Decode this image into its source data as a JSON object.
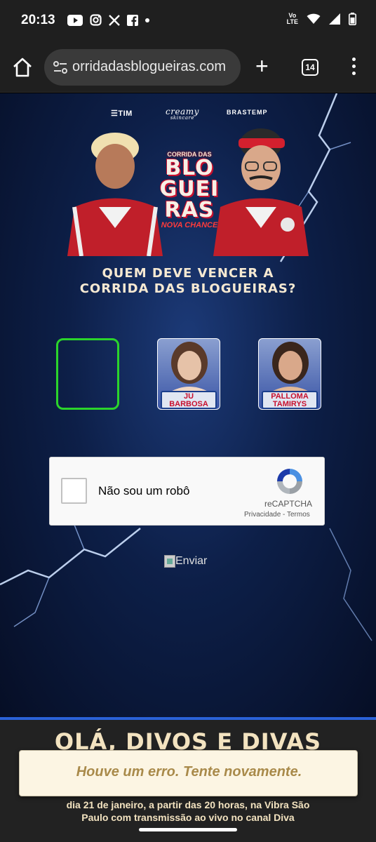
{
  "status_bar": {
    "time": "20:13",
    "notification_icons": [
      "youtube-icon",
      "instagram-icon",
      "x-icon",
      "facebook-icon",
      "dot-icon"
    ],
    "network_label_top": "Vo",
    "network_label_bottom": "LTE",
    "system_icons": [
      "wifi-icon",
      "signal-icon",
      "battery-icon"
    ]
  },
  "browser": {
    "url": "orridadasblogueiras.com",
    "tab_count": "14",
    "icons": [
      "home-icon",
      "site-settings-icon",
      "new-tab-icon",
      "tabs-icon",
      "menu-icon"
    ]
  },
  "sponsors": {
    "tim": "☰TIM",
    "creamy": "creamy",
    "creamy_sub": "skincare",
    "brastemp": "BRASTEMP"
  },
  "hero_logo": {
    "line_top": "CORRIDA DAS",
    "line1": "BLO",
    "line2": "GUEI",
    "line3": "RAS",
    "subtitle": "NOVA CHANCE"
  },
  "question": {
    "line1": "QUEM DEVE VENCER A",
    "line2": "CORRIDA DAS BLOGUEIRAS?"
  },
  "candidates": [
    {
      "name_line1": "",
      "name_line2": "",
      "selected": true
    },
    {
      "name_line1": "JU",
      "name_line2": "BARBOSA",
      "selected": false
    },
    {
      "name_line1": "PALLOMA",
      "name_line2": "TAMIRYS",
      "selected": false
    }
  ],
  "recaptcha": {
    "label": "Não sou um robô",
    "brand": "reCAPTCHA",
    "privacy": "Privacidade",
    "separator": "-",
    "terms": "Termos"
  },
  "submit": {
    "alt_text": "Enviar"
  },
  "footer": {
    "title": "OLÁ, DIVOS E DIVAS",
    "text_line1": "dia 21 de janeiro, a partir das 20 horas, na Vibra São",
    "text_line2": "Paulo com transmissão ao vivo no canal Diva"
  },
  "toast": {
    "message": "Houve um erro. Tente novamente."
  },
  "colors": {
    "selection_border": "#2bd42b",
    "footer_accent": "#2a62d8",
    "cream_text": "#f3e3c0",
    "toast_text": "#a98a4a"
  }
}
